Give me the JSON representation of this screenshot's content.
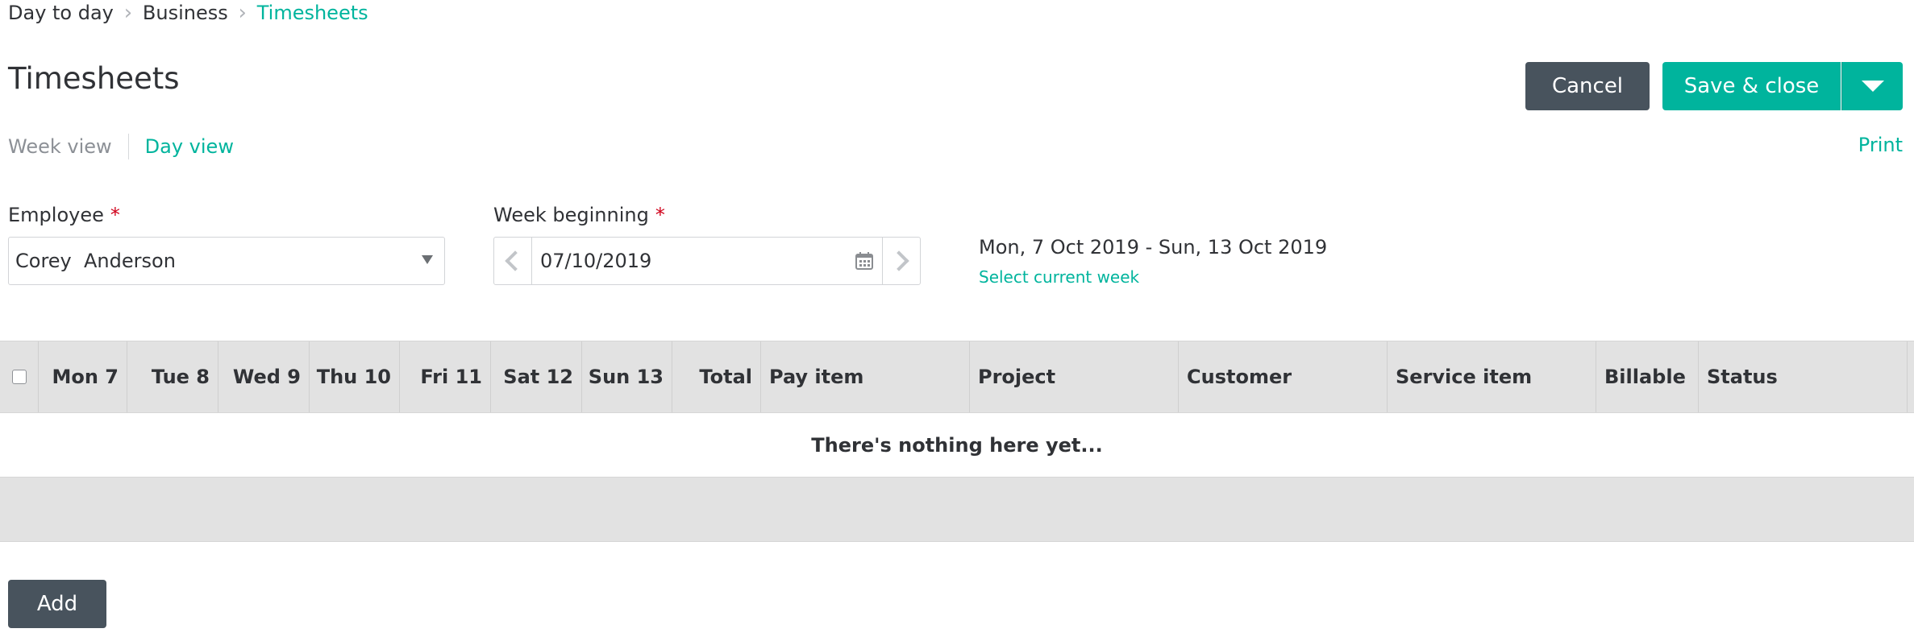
{
  "breadcrumb": {
    "items": [
      "Day to day",
      "Business",
      "Timesheets"
    ]
  },
  "page": {
    "title": "Timesheets"
  },
  "actions": {
    "cancel_label": "Cancel",
    "save_label": "Save & close",
    "save_menu_icon": "caret-down-icon"
  },
  "tabs": {
    "week_view": "Week view",
    "day_view": "Day view",
    "active": "Day view"
  },
  "print_label": "Print",
  "employee": {
    "label": "Employee",
    "required_mark": "*",
    "value": "Corey  Anderson"
  },
  "week_beginning": {
    "label": "Week beginning",
    "required_mark": "*",
    "value": "07/10/2019"
  },
  "date_range": {
    "text": "Mon, 7 Oct 2019 - Sun, 13 Oct 2019",
    "select_current": "Select current week"
  },
  "table": {
    "columns": [
      "Mon 7",
      "Tue 8",
      "Wed 9",
      "Thu 10",
      "Fri 11",
      "Sat 12",
      "Sun 13",
      "Total",
      "Pay item",
      "Project",
      "Customer",
      "Service item",
      "Billable",
      "Status"
    ],
    "empty_message": "There's nothing here yet..."
  },
  "add_label": "Add",
  "colors": {
    "accent": "#00b49d",
    "dark_button": "#48535d",
    "required": "#d0021b",
    "header_bg": "#e2e2e2"
  }
}
